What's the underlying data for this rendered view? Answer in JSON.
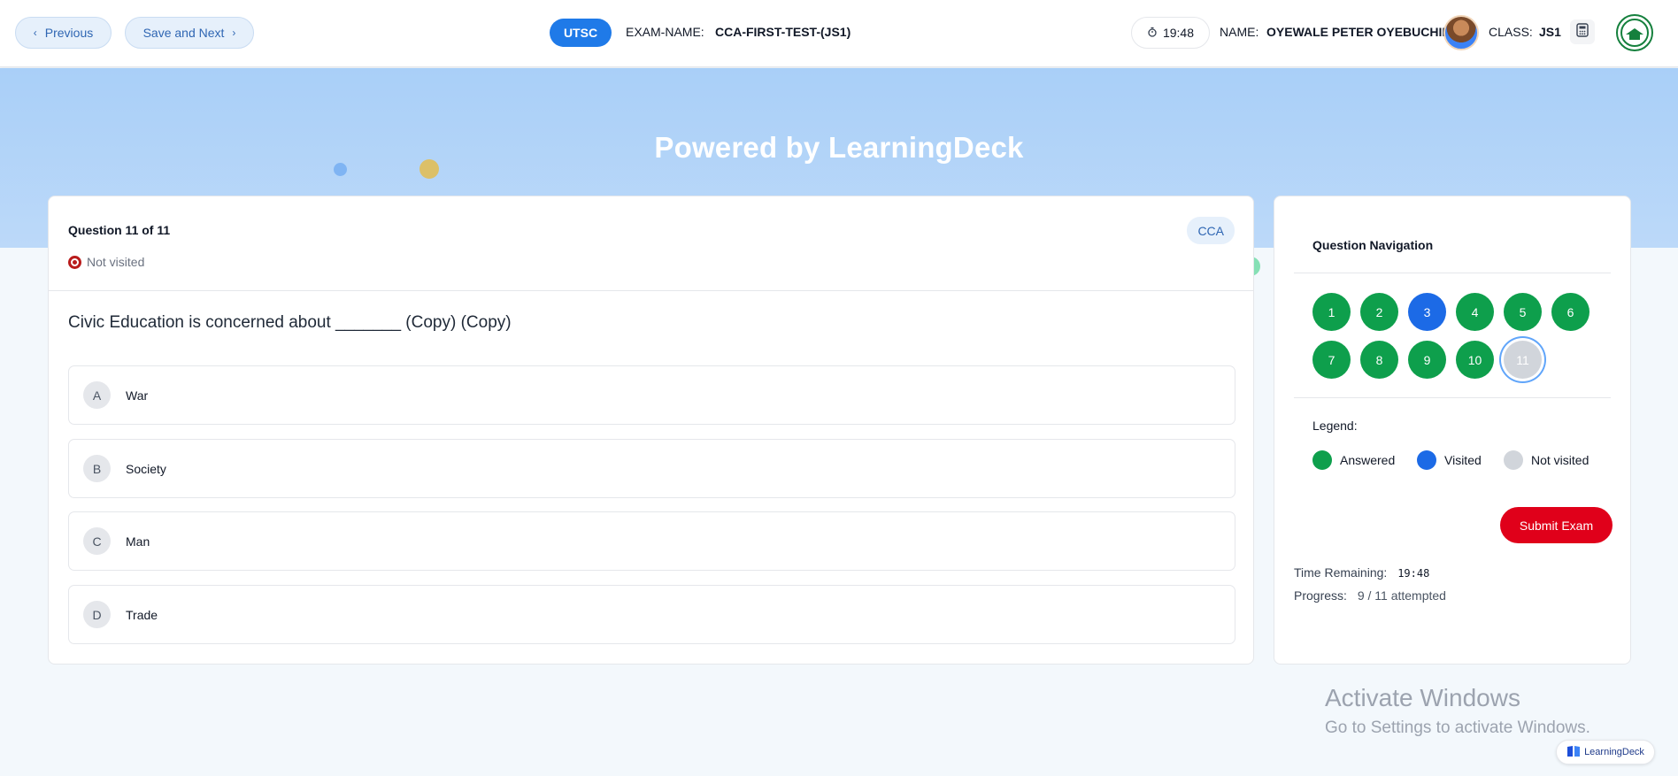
{
  "header": {
    "previous_label": "Previous",
    "save_next_label": "Save and Next",
    "school_badge": "UTSC",
    "exam_name_label": "EXAM-NAME:",
    "exam_name": "CCA-FIRST-TEST-(JS1)",
    "timer": "19:48",
    "name_label": "NAME:",
    "student_name": "OYEWALE PETER OYEBUCHII",
    "class_label": "CLASS:",
    "class_value": "JS1",
    "icons": [
      "chevron-left-icon",
      "chevron-right-icon",
      "timer-icon",
      "avatar",
      "calculator-icon",
      "school-logo"
    ]
  },
  "hero": {
    "title": "Powered by LearningDeck",
    "colors": {
      "band": "#a9cff8",
      "dot_blue": "#7fb4f3",
      "dot_gold": "#dcc068"
    }
  },
  "question": {
    "counter": "Question 11 of 11",
    "status": "Not visited",
    "subject": "CCA",
    "text": "Civic Education is concerned about _______ (Copy) (Copy)",
    "options": [
      {
        "letter": "A",
        "text": "War"
      },
      {
        "letter": "B",
        "text": "Society"
      },
      {
        "letter": "C",
        "text": "Man"
      },
      {
        "letter": "D",
        "text": "Trade"
      }
    ]
  },
  "navigation": {
    "title": "Question Navigation",
    "buttons": [
      {
        "label": "1",
        "state": "answered"
      },
      {
        "label": "2",
        "state": "answered"
      },
      {
        "label": "3",
        "state": "visited"
      },
      {
        "label": "4",
        "state": "answered"
      },
      {
        "label": "5",
        "state": "answered"
      },
      {
        "label": "6",
        "state": "answered"
      },
      {
        "label": "7",
        "state": "answered"
      },
      {
        "label": "8",
        "state": "answered"
      },
      {
        "label": "9",
        "state": "answered"
      },
      {
        "label": "10",
        "state": "answered"
      },
      {
        "label": "11",
        "state": "notvisited"
      }
    ],
    "legend_title": "Legend:",
    "legend": [
      {
        "label": "Answered",
        "color": "#0e9f4c"
      },
      {
        "label": "Visited",
        "color": "#1c6ae6"
      },
      {
        "label": "Not visited",
        "color": "#d1d5db"
      }
    ],
    "submit_label": "Submit Exam",
    "time_remaining_label": "Time Remaining:",
    "time_remaining": "19:48",
    "progress_label": "Progress:",
    "progress_value": "9 / 11 attempted"
  },
  "watermark": {
    "title": "Activate Windows",
    "subtitle": "Go to Settings to activate Windows."
  },
  "brand_chip": {
    "label": "LearningDeck"
  },
  "colors": {
    "accent": "#1f7ae8",
    "answered": "#0e9f4c",
    "visited": "#1c6ae6",
    "not_visited": "#d1d5db",
    "submit": "#e0001a"
  }
}
